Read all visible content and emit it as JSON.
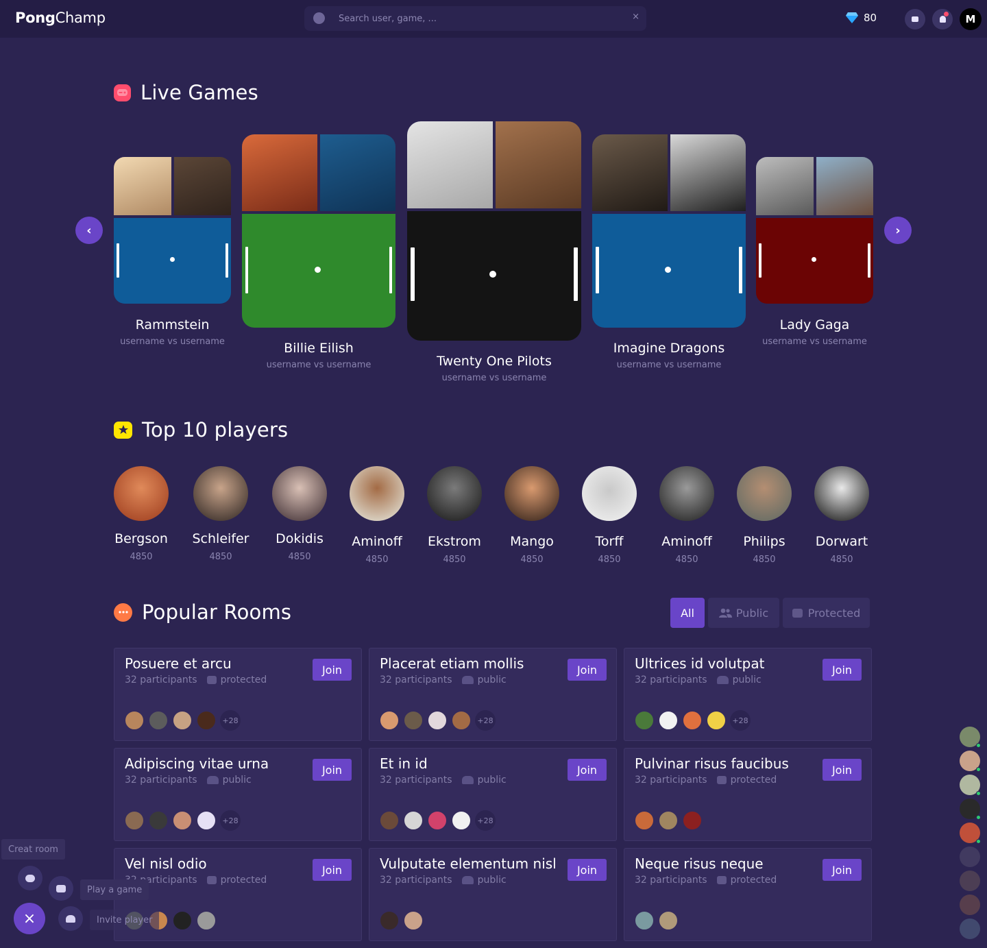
{
  "header": {
    "logo_bold": "Pong",
    "logo_rest": "Champ",
    "search_placeholder": "Search user, game, ...",
    "search_clear": "×",
    "gems": "80",
    "avatar_letter": "M"
  },
  "live": {
    "title": "Live Games",
    "prev": "‹",
    "next": "›",
    "games": [
      {
        "name": "Rammstein",
        "sub": "username vs username",
        "court_color": "#0f5c99"
      },
      {
        "name": "Billie Eilish",
        "sub": "username vs username",
        "court_color": "#2f8a2c"
      },
      {
        "name": "Twenty One Pilots",
        "sub": "username vs username",
        "court_color": "#141414"
      },
      {
        "name": "Imagine Dragons",
        "sub": "username vs username",
        "court_color": "#0f5c99"
      },
      {
        "name": "Lady Gaga",
        "sub": "username vs username",
        "court_color": "#6b0404"
      }
    ]
  },
  "top": {
    "title": "Top 10 players",
    "players": [
      {
        "name": "Bergson",
        "score": "4850"
      },
      {
        "name": "Schleifer",
        "score": "4850"
      },
      {
        "name": "Dokidis",
        "score": "4850"
      },
      {
        "name": "Aminoff",
        "score": "4850"
      },
      {
        "name": "Ekstrom",
        "score": "4850"
      },
      {
        "name": "Mango",
        "score": "4850"
      },
      {
        "name": "Torff",
        "score": "4850"
      },
      {
        "name": "Aminoff",
        "score": "4850"
      },
      {
        "name": "Philips",
        "score": "4850"
      },
      {
        "name": "Dorwart",
        "score": "4850"
      }
    ]
  },
  "rooms": {
    "title": "Popular Rooms",
    "filters": {
      "all": "All",
      "public": "Public",
      "protected": "Protected"
    },
    "join_label": "Join",
    "items": [
      {
        "name": "Posuere et arcu",
        "participants": "32 participants",
        "type": "protected",
        "more": "+28"
      },
      {
        "name": "Placerat etiam mollis",
        "participants": "32 participants",
        "type": "public",
        "more": "+28"
      },
      {
        "name": "Ultrices id volutpat",
        "participants": "32 participants",
        "type": "public",
        "more": "+28"
      },
      {
        "name": "Adipiscing vitae urna",
        "participants": "32 participants",
        "type": "public",
        "more": "+28"
      },
      {
        "name": "Et in id",
        "participants": "32 participants",
        "type": "public",
        "more": "+28"
      },
      {
        "name": "Pulvinar risus faucibus",
        "participants": "32 participants",
        "type": "protected",
        "more": ""
      },
      {
        "name": "Vel nisl odio",
        "participants": "32 participants",
        "type": "protected",
        "more": ""
      },
      {
        "name": "Vulputate elementum nisl",
        "participants": "32 participants",
        "type": "public",
        "more": ""
      },
      {
        "name": "Neque risus neque",
        "participants": "32 participants",
        "type": "protected",
        "more": ""
      }
    ]
  },
  "fab": {
    "create_room": "Creat room",
    "play_game": "Play a game",
    "invite_player": "Invite player",
    "close": "×"
  },
  "colors": {
    "background": "#2c2451",
    "accent": "#6a45c8",
    "online": "#2ecc71"
  }
}
